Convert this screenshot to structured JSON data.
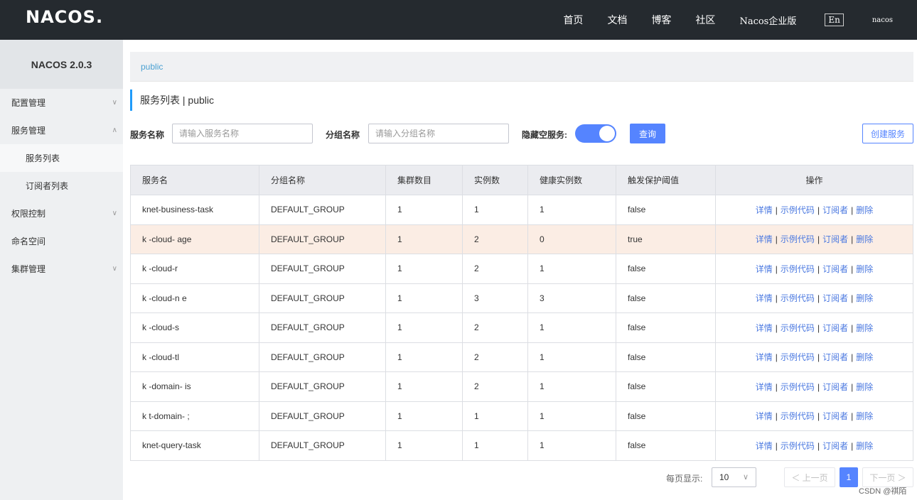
{
  "topbar": {
    "logo": "NACOS.",
    "nav": [
      "首页",
      "文档",
      "博客",
      "社区",
      "Nacos企业版"
    ],
    "lang": "En",
    "user": "nacos"
  },
  "sidebar": {
    "version": "NACOS 2.0.3",
    "items": [
      {
        "label": "配置管理",
        "chevron": "∨"
      },
      {
        "label": "服务管理",
        "chevron": "∧"
      },
      {
        "label": "服务列表"
      },
      {
        "label": "订阅者列表"
      },
      {
        "label": "权限控制",
        "chevron": "∨"
      },
      {
        "label": "命名空间"
      },
      {
        "label": "集群管理",
        "chevron": "∨"
      }
    ]
  },
  "namespace": "public",
  "page_title": "服务列表 | public",
  "filters": {
    "service_label": "服务名称",
    "service_placeholder": "请输入服务名称",
    "group_label": "分组名称",
    "group_placeholder": "请输入分组名称",
    "hide_empty_label": "隐藏空服务:",
    "query_button": "查询",
    "create_button": "创建服务"
  },
  "table": {
    "headers": [
      "服务名",
      "分组名称",
      "集群数目",
      "实例数",
      "健康实例数",
      "触发保护阈值",
      "操作"
    ],
    "ops": [
      "详情",
      "示例代码",
      "订阅者",
      "删除"
    ],
    "rows": [
      {
        "name": "knet-business-task",
        "group": "DEFAULT_GROUP",
        "clusters": "1",
        "instances": "1",
        "healthy": "1",
        "protect": "false"
      },
      {
        "name": "k   -cloud-   age",
        "group": "DEFAULT_GROUP",
        "clusters": "1",
        "instances": "2",
        "healthy": "0",
        "protect": "true"
      },
      {
        "name": "k   -cloud-r",
        "group": "DEFAULT_GROUP",
        "clusters": "1",
        "instances": "2",
        "healthy": "1",
        "protect": "false"
      },
      {
        "name": "k   -cloud-n   e",
        "group": "DEFAULT_GROUP",
        "clusters": "1",
        "instances": "3",
        "healthy": "3",
        "protect": "false"
      },
      {
        "name": "k   -cloud-s",
        "group": "DEFAULT_GROUP",
        "clusters": "1",
        "instances": "2",
        "healthy": "1",
        "protect": "false"
      },
      {
        "name": "k   -cloud-tl",
        "group": "DEFAULT_GROUP",
        "clusters": "1",
        "instances": "2",
        "healthy": "1",
        "protect": "false"
      },
      {
        "name": "k   -domain-   is",
        "group": "DEFAULT_GROUP",
        "clusters": "1",
        "instances": "2",
        "healthy": "1",
        "protect": "false"
      },
      {
        "name": "k   t-domain-   ;",
        "group": "DEFAULT_GROUP",
        "clusters": "1",
        "instances": "1",
        "healthy": "1",
        "protect": "false"
      },
      {
        "name": "knet-query-task",
        "group": "DEFAULT_GROUP",
        "clusters": "1",
        "instances": "1",
        "healthy": "1",
        "protect": "false"
      }
    ]
  },
  "pagination": {
    "per_page_label": "每页显示:",
    "per_page": "10",
    "prev": "＜ 上一页",
    "current": "1",
    "next": "下一页 ＞"
  },
  "watermark": "CSDN @祺陌",
  "colors": {
    "primary": "#5584ff",
    "topbar": "#252a2f",
    "highlight_row": "#fbede4"
  }
}
